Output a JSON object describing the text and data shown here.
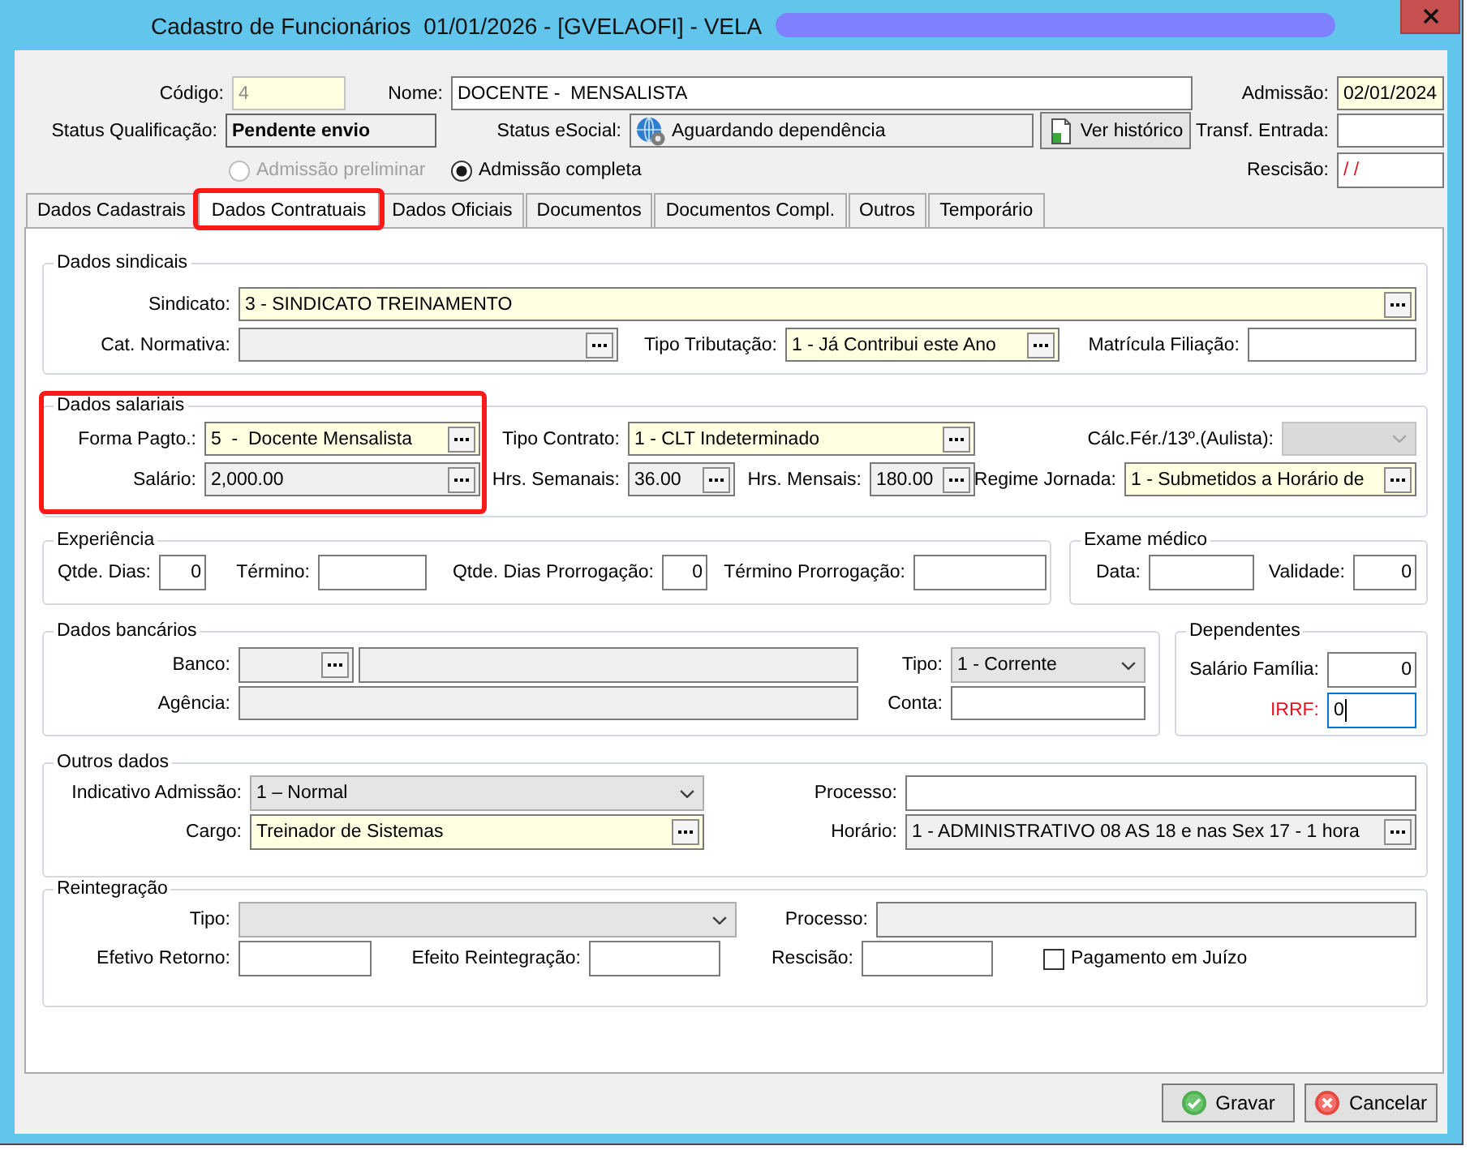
{
  "window": {
    "title": "Cadastro de Funcionários  01/01/2026 - [GVELAOFI] - VELA",
    "title_redacted": true
  },
  "header": {
    "fields": [
      {
        "label": "Código:",
        "kind": "text",
        "value": "4",
        "required": true,
        "readonly": false,
        "disabled": true
      },
      {
        "label": "Nome:",
        "kind": "text",
        "value": "DOCENTE -  MENSALISTA",
        "required": false,
        "readonly": false,
        "disabled": false
      },
      {
        "label": "Admissão:",
        "kind": "text",
        "value": "02/01/2024",
        "required": true,
        "readonly": false,
        "disabled": false,
        "mask": false
      },
      {
        "label": "Status Qualificação:",
        "kind": "status",
        "value": "Pendente envio",
        "required": false,
        "readonly": true,
        "disabled": false
      },
      {
        "label": "Status eSocial:",
        "kind": "status_icon",
        "value": "Aguardando dependência",
        "required": false,
        "readonly": true,
        "disabled": false
      },
      {
        "kind": "button",
        "text": "Ver histórico"
      },
      {
        "label": "Transf. Entrada:",
        "kind": "text",
        "required": false,
        "readonly": false,
        "disabled": false
      },
      {
        "kind": "radio",
        "text": "Admissão preliminar",
        "selected": false,
        "disabled": true
      },
      {
        "kind": "radio",
        "text": "Admissão completa",
        "selected": true,
        "disabled": false
      },
      {
        "label": "Rescisão:",
        "kind": "text",
        "value": "/ /",
        "required": false,
        "readonly": false,
        "disabled": false,
        "mask": true
      }
    ]
  },
  "tabs": [
    {
      "label": "Dados Cadastrais",
      "selected": false,
      "highlighted": false
    },
    {
      "label": "Dados Contratuais",
      "selected": true,
      "highlighted": true
    },
    {
      "label": "Dados Oficiais",
      "selected": false,
      "highlighted": false
    },
    {
      "label": "Documentos",
      "selected": false,
      "highlighted": false
    },
    {
      "label": "Documentos Compl.",
      "selected": false,
      "highlighted": false
    },
    {
      "label": "Outros",
      "selected": false,
      "highlighted": false
    },
    {
      "label": "Temporário",
      "selected": false,
      "highlighted": false
    }
  ],
  "groups": [
    {
      "title": "Dados sindicais",
      "highlighted": false,
      "fields": [
        {
          "label": "Sindicato:",
          "kind": "lookup",
          "value": "3 - SINDICATO TREINAMENTO",
          "required": true,
          "readonly": false,
          "disabled": false
        },
        {
          "label": "Cat. Normativa:",
          "kind": "lookup",
          "required": false,
          "readonly": true,
          "disabled": false
        },
        {
          "label": "Tipo Tributação:",
          "kind": "lookup",
          "value": "1 - Já Contribui este Ano",
          "required": true,
          "readonly": false,
          "disabled": false
        },
        {
          "label": "Matrícula Filiação:",
          "kind": "text",
          "required": false,
          "readonly": false,
          "disabled": false
        }
      ]
    },
    {
      "title": "Dados salariais",
      "highlighted": true,
      "fields": [
        {
          "label": "Forma Pagto.:",
          "kind": "lookup",
          "value": "5  -  Docente Mensalista",
          "required": true,
          "readonly": false,
          "disabled": false
        },
        {
          "label": "Tipo Contrato:",
          "kind": "lookup",
          "value": "1 - CLT Indeterminado",
          "required": true,
          "readonly": false,
          "disabled": false
        },
        {
          "label": "Cálc.Fér./13º.(Aulista):",
          "kind": "combo",
          "required": false,
          "readonly": true,
          "disabled": true
        },
        {
          "label": "Salário:",
          "kind": "lookup",
          "value": "2,000.00",
          "required": false,
          "readonly": true,
          "disabled": false
        },
        {
          "label": "Hrs. Semanais:",
          "kind": "lookup",
          "value": "36.00",
          "required": false,
          "readonly": true,
          "disabled": false
        },
        {
          "label": "Hrs. Mensais:",
          "kind": "lookup",
          "value": "180.00",
          "required": false,
          "readonly": true,
          "disabled": false
        },
        {
          "label": "Regime Jornada:",
          "kind": "lookup",
          "value": "1 - Submetidos a Horário de",
          "required": true,
          "readonly": false,
          "disabled": false
        }
      ]
    },
    {
      "title": "Experiência",
      "highlighted": false,
      "fields": [
        {
          "label": "Qtde. Dias:",
          "kind": "number",
          "value": "0",
          "required": false,
          "readonly": false,
          "disabled": false
        },
        {
          "label": "Término:",
          "kind": "text",
          "required": false,
          "readonly": false,
          "disabled": false
        },
        {
          "label": "Qtde. Dias Prorrogação:",
          "kind": "number",
          "value": "0",
          "required": false,
          "readonly": false,
          "disabled": false
        },
        {
          "label": "Término Prorrogação:",
          "kind": "text",
          "required": false,
          "readonly": false,
          "disabled": false
        }
      ]
    },
    {
      "title": "Exame médico",
      "highlighted": false,
      "fields": [
        {
          "label": "Data:",
          "kind": "text",
          "required": false,
          "readonly": false,
          "disabled": false
        },
        {
          "label": "Validade:",
          "kind": "number",
          "value": "0",
          "required": false,
          "readonly": false,
          "disabled": false
        }
      ]
    },
    {
      "title": "Dados bancários",
      "highlighted": false,
      "fields": [
        {
          "label": "Banco:",
          "kind": "lookup",
          "required": false,
          "readonly": true,
          "disabled": false
        },
        {
          "kind": "text",
          "required": false,
          "readonly": true,
          "disabled": false
        },
        {
          "label": "Tipo:",
          "kind": "combo",
          "value": "1 - Corrente",
          "required": false,
          "readonly": true,
          "disabled": false
        },
        {
          "label": "Agência:",
          "kind": "text",
          "required": false,
          "readonly": true,
          "disabled": false
        },
        {
          "label": "Conta:",
          "kind": "text",
          "required": false,
          "readonly": false,
          "disabled": false
        }
      ]
    },
    {
      "title": "Dependentes",
      "highlighted": false,
      "fields": [
        {
          "label": "Salário Família:",
          "kind": "number",
          "value": "0",
          "required": false,
          "readonly": false,
          "disabled": false,
          "focused": false,
          "alert": false
        },
        {
          "label": "IRRF:",
          "kind": "text",
          "value": "0",
          "required": false,
          "readonly": false,
          "disabled": false,
          "focused": true,
          "alert": true
        }
      ]
    },
    {
      "title": "Outros dados",
      "highlighted": false,
      "fields": [
        {
          "label": "Indicativo Admissão:",
          "kind": "combo",
          "value": "1 – Normal",
          "required": false,
          "readonly": true,
          "disabled": false
        },
        {
          "label": "Processo:",
          "kind": "text",
          "required": false,
          "readonly": false,
          "disabled": false
        },
        {
          "label": "Cargo:",
          "kind": "lookup",
          "value": "Treinador de Sistemas",
          "required": true,
          "readonly": false,
          "disabled": false
        },
        {
          "label": "Horário:",
          "kind": "lookup",
          "value": "1 - ADMINISTRATIVO 08 AS 18 e nas Sex 17 - 1 hora",
          "required": false,
          "readonly": true,
          "disabled": false
        }
      ]
    },
    {
      "title": "Reintegração",
      "highlighted": false,
      "fields": [
        {
          "label": "Tipo:",
          "kind": "combo",
          "required": false,
          "readonly": true,
          "disabled": false
        },
        {
          "label": "Processo:",
          "kind": "text",
          "required": false,
          "readonly": true,
          "disabled": false
        },
        {
          "label": "Efetivo Retorno:",
          "kind": "text",
          "required": false,
          "readonly": false,
          "disabled": false
        },
        {
          "label": "Efeito Reintegração:",
          "kind": "text",
          "required": false,
          "readonly": false,
          "disabled": false
        },
        {
          "label": "Rescisão:",
          "kind": "text",
          "required": false,
          "readonly": false,
          "disabled": false
        },
        {
          "kind": "checkbox",
          "text": "Pagamento em Juízo",
          "checked": false
        }
      ]
    }
  ],
  "buttons": [
    {
      "kind": "save",
      "label": "Gravar"
    },
    {
      "kind": "cancel",
      "label": "Cancelar"
    }
  ]
}
